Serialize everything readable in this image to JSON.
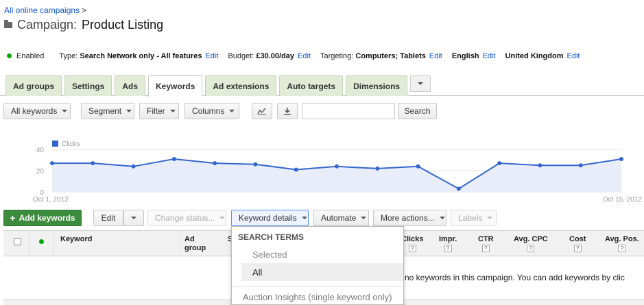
{
  "breadcrumb": {
    "link": "All online campaigns",
    "sep": ">"
  },
  "campaign": {
    "prefix": "Campaign:",
    "name": "Product Listing"
  },
  "settings": {
    "status": "Enabled",
    "type_label": "Type:",
    "type_value": "Search Network only - All features",
    "budget_label": "Budget:",
    "budget_value": "£30.00/day",
    "targeting_label": "Targeting:",
    "targeting_value": "Computers; Tablets",
    "language": "English",
    "location": "United Kingdom",
    "edit": "Edit"
  },
  "tabs": [
    "Ad groups",
    "Settings",
    "Ads",
    "Keywords",
    "Ad extensions",
    "Auto targets",
    "Dimensions"
  ],
  "active_tab": "Keywords",
  "toolbar": {
    "all_keywords": "All keywords",
    "segment": "Segment",
    "filter": "Filter",
    "columns": "Columns",
    "search_value": "",
    "search_button": "Search"
  },
  "chart_data": {
    "type": "line",
    "legend": "Clicks",
    "series_color": "#3366cc",
    "x_start_label": "Oct 1, 2012",
    "x_end_label": "Oct 15, 2012",
    "y_ticks": [
      "40",
      "20",
      "0"
    ],
    "ylim": [
      0,
      40
    ],
    "x": [
      "Oct 1, 2012",
      "Oct 2, 2012",
      "Oct 3, 2012",
      "Oct 4, 2012",
      "Oct 5, 2012",
      "Oct 6, 2012",
      "Oct 7, 2012",
      "Oct 8, 2012",
      "Oct 9, 2012",
      "Oct 10, 2012",
      "Oct 11, 2012",
      "Oct 12, 2012",
      "Oct 13, 2012",
      "Oct 14, 2012",
      "Oct 15, 2012"
    ],
    "values": [
      27,
      27,
      24,
      31,
      27,
      26,
      21,
      24,
      22,
      24,
      3,
      27,
      25,
      25,
      31
    ],
    "grid": true
  },
  "actions": {
    "add_keywords": "Add keywords",
    "edit": "Edit",
    "change_status": "Change status...",
    "keyword_details": "Keyword details",
    "automate": "Automate",
    "more_actions": "More actions...",
    "labels": "Labels"
  },
  "table": {
    "columns": [
      "Keyword",
      "Ad group",
      "S",
      "Clicks",
      "Impr.",
      "CTR",
      "Avg. CPC",
      "Cost",
      "Avg. Pos."
    ],
    "help_glyph": "?",
    "empty_message": "no keywords in this campaign. You can add keywords by clic"
  },
  "dropdown": {
    "heading": "SEARCH TERMS",
    "selected": "Selected",
    "all": "All",
    "auction": "Auction Insights (single keyword only)"
  }
}
